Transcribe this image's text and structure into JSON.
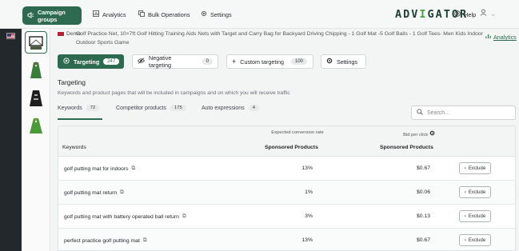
{
  "nav": {
    "campaign_groups": "Campaign groups",
    "analytics": "Analytics",
    "bulk_operations": "Bulk Operations",
    "settings": "Settings",
    "logo_left": "ADV",
    "logo_accent": "I",
    "logo_right": "GATOR",
    "help": "Help",
    "icons": {
      "campaign": "megaphone-icon",
      "analytics": "chart-icon",
      "bulk": "layers-icon",
      "settings": "gear-icon",
      "help": "help-icon",
      "user": "user-icon"
    }
  },
  "product": {
    "marketplace": "Demo",
    "title": "Golf Practice Net, 10×7ft Golf Hitting Training Aids Nets with Target and Carry Bag for Backyard Driving Chipping - 1 Golf Mat -5 Golf Balls - 1 Golf Tees- Men Kids Indoor Outdoor Sports Game",
    "analytics_link": "Analytics"
  },
  "tabs": [
    {
      "label": "Targeting",
      "count": "247",
      "icon": "target-icon"
    },
    {
      "label": "Negative targeting",
      "count": "0",
      "icon": "eye-off-icon"
    },
    {
      "label": "Custom targeting",
      "count": "100",
      "icon": "plus-icon"
    },
    {
      "label": "Settings",
      "count": "",
      "icon": "gear-icon"
    }
  ],
  "section": {
    "title": "Targeting",
    "description": "Keywords and product pages that will be included in campaigns and on which you will receive traffic"
  },
  "subtabs": [
    {
      "label": "Keywords",
      "count": "72"
    },
    {
      "label": "Competitor products",
      "count": "175"
    },
    {
      "label": "Auto expressions",
      "count": "4"
    }
  ],
  "search": {
    "placeholder": "Search..."
  },
  "table": {
    "col_keywords": "Keywords",
    "conv_group": "Expected conversion rate",
    "conv_sub": "Sponsored Products",
    "bid_group": "Bid per click",
    "bid_sub": "Sponsored Products",
    "exclude_label": "Exclude",
    "rows": [
      {
        "keyword": "golf putting mat for indoors",
        "conversion": "13%",
        "bid": "$0.67"
      },
      {
        "keyword": "golf putting mat return",
        "conversion": "1%",
        "bid": "$0.06"
      },
      {
        "keyword": "golf putting mat with battery operated ball return",
        "conversion": "3%",
        "bid": "$0.13"
      },
      {
        "keyword": "perfect practice golf putting mat",
        "conversion": "13%",
        "bid": "$0.67"
      }
    ]
  }
}
